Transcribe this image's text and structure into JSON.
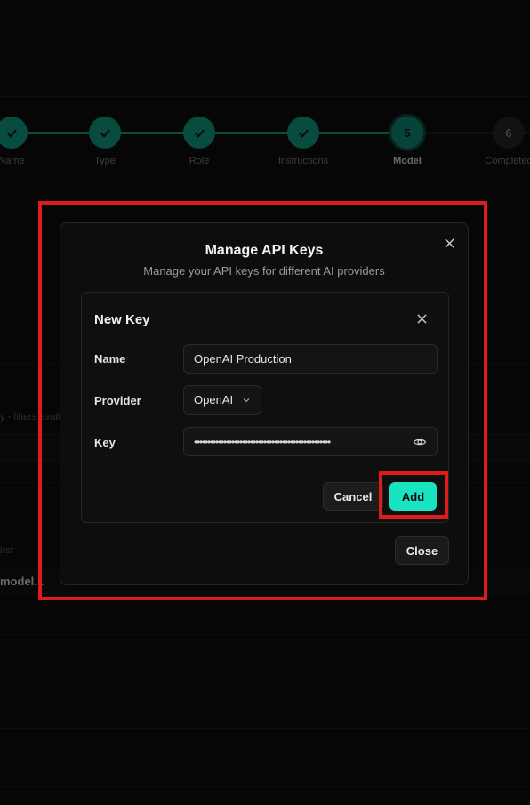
{
  "stepper": {
    "steps": [
      {
        "label": "Name",
        "status": "done"
      },
      {
        "label": "Type",
        "status": "done"
      },
      {
        "label": "Role",
        "status": "done"
      },
      {
        "label": "Instructions",
        "status": "done"
      },
      {
        "label": "Model",
        "status": "current",
        "number": "5"
      },
      {
        "label": "Completed",
        "status": "todo",
        "number": "6"
      }
    ]
  },
  "background": {
    "filter_hint": "y - filters availa",
    "sort_hint": "irst",
    "row_text": "model..."
  },
  "dialog": {
    "title": "Manage API Keys",
    "subtitle": "Manage your API keys for different AI providers",
    "close_label": "Close",
    "close_icon": "close-icon"
  },
  "new_key": {
    "title": "New Key",
    "name_label": "Name",
    "name_value": "OpenAI Production",
    "provider_label": "Provider",
    "provider_value": "OpenAI",
    "key_label": "Key",
    "key_value": "•••••••••••••••••••••••••••••••••••••••••••••••••••",
    "cancel_label": "Cancel",
    "add_label": "Add"
  },
  "colors": {
    "accent": "#19e3c1",
    "step_done": "#0e8a73",
    "highlight": "#e01b1b",
    "background": "#0b0b0b"
  }
}
